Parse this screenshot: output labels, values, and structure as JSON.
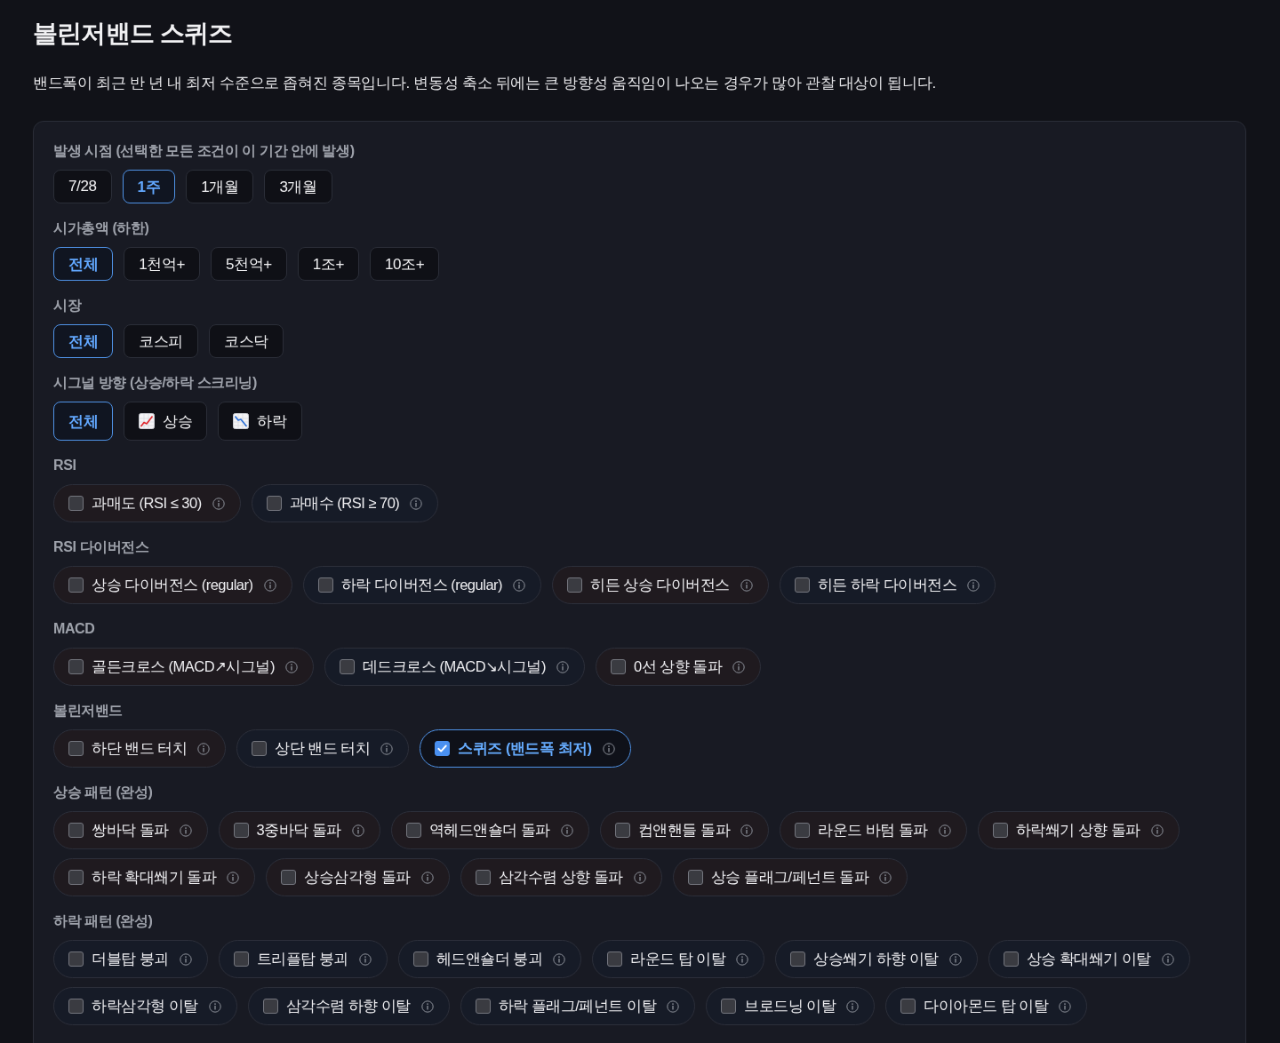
{
  "page": {
    "title": "볼린저밴드 스퀴즈",
    "description": "밴드폭이 최근 반 년 내 최저 수준으로 좁혀진 종목입니다. 변동성 축소 뒤에는 큰 방향성 움직임이 나오는 경우가 많아 관찰 대상이 됩니다."
  },
  "filters": {
    "groups": [
      {
        "kind": "buttons",
        "label": "발생 시점 (선택한 모든 조건이 이 기간 안에 발생)",
        "options": [
          {
            "label": "7/28",
            "selected": false
          },
          {
            "label": "1주",
            "selected": true
          },
          {
            "label": "1개월",
            "selected": false
          },
          {
            "label": "3개월",
            "selected": false
          }
        ]
      },
      {
        "kind": "buttons",
        "label": "시가총액 (하한)",
        "options": [
          {
            "label": "전체",
            "selected": true
          },
          {
            "label": "1천억+",
            "selected": false
          },
          {
            "label": "5천억+",
            "selected": false
          },
          {
            "label": "1조+",
            "selected": false
          },
          {
            "label": "10조+",
            "selected": false
          }
        ]
      },
      {
        "kind": "buttons",
        "label": "시장",
        "options": [
          {
            "label": "전체",
            "selected": true
          },
          {
            "label": "코스피",
            "selected": false
          },
          {
            "label": "코스닥",
            "selected": false
          }
        ]
      },
      {
        "kind": "buttons",
        "label": "시그널 방향 (상승/하락 스크리닝)",
        "options": [
          {
            "label": "전체",
            "selected": true,
            "kind": "plain"
          },
          {
            "label": "상승",
            "selected": false,
            "kind": "rising"
          },
          {
            "label": "하락",
            "selected": false,
            "kind": "falling"
          }
        ]
      },
      {
        "kind": "checkboxes",
        "label": "RSI",
        "options": [
          {
            "label": "과매도 (RSI ≤ 30)",
            "checked": false,
            "kind": "bullish"
          },
          {
            "label": "과매수 (RSI ≥ 70)",
            "checked": false,
            "kind": "bearish"
          }
        ]
      },
      {
        "kind": "checkboxes",
        "label": "RSI 다이버전스",
        "options": [
          {
            "label": "상승 다이버전스 (regular)",
            "checked": false,
            "kind": "bullish"
          },
          {
            "label": "하락 다이버전스 (regular)",
            "checked": false,
            "kind": "bearish"
          },
          {
            "label": "히든 상승 다이버전스",
            "checked": false,
            "kind": "bullish"
          },
          {
            "label": "히든 하락 다이버전스",
            "checked": false,
            "kind": "bearish"
          }
        ]
      },
      {
        "kind": "checkboxes",
        "label": "MACD",
        "options": [
          {
            "label": "골든크로스 (MACD↗시그널)",
            "checked": false,
            "kind": "bullish"
          },
          {
            "label": "데드크로스 (MACD↘시그널)",
            "checked": false,
            "kind": "bearish"
          },
          {
            "label": "0선 상향 돌파",
            "checked": false,
            "kind": "bullish"
          }
        ]
      },
      {
        "kind": "checkboxes",
        "label": "볼린저밴드",
        "options": [
          {
            "label": "하단 밴드 터치",
            "checked": false,
            "kind": "bullish"
          },
          {
            "label": "상단 밴드 터치",
            "checked": false,
            "kind": "bearish"
          },
          {
            "label": "스퀴즈 (밴드폭 최저)",
            "checked": true,
            "kind": "neutral"
          }
        ]
      },
      {
        "kind": "checkboxes",
        "label": "상승 패턴 (완성)",
        "options": [
          {
            "label": "쌍바닥 돌파",
            "checked": false,
            "kind": "bullish"
          },
          {
            "label": "3중바닥 돌파",
            "checked": false,
            "kind": "bullish"
          },
          {
            "label": "역헤드앤숄더 돌파",
            "checked": false,
            "kind": "bullish"
          },
          {
            "label": "컵앤핸들 돌파",
            "checked": false,
            "kind": "bullish"
          },
          {
            "label": "라운드 바텀 돌파",
            "checked": false,
            "kind": "bullish"
          },
          {
            "label": "하락쐐기 상향 돌파",
            "checked": false,
            "kind": "bullish"
          },
          {
            "label": "하락 확대쐐기 돌파",
            "checked": false,
            "kind": "bullish"
          },
          {
            "label": "상승삼각형 돌파",
            "checked": false,
            "kind": "bullish"
          },
          {
            "label": "삼각수렴 상향 돌파",
            "checked": false,
            "kind": "bullish"
          },
          {
            "label": "상승 플래그/페넌트 돌파",
            "checked": false,
            "kind": "bullish"
          }
        ]
      },
      {
        "kind": "checkboxes",
        "label": "하락 패턴 (완성)",
        "options": [
          {
            "label": "더블탑 붕괴",
            "checked": false,
            "kind": "bearish"
          },
          {
            "label": "트리플탑 붕괴",
            "checked": false,
            "kind": "bearish"
          },
          {
            "label": "헤드앤숄더 붕괴",
            "checked": false,
            "kind": "bearish"
          },
          {
            "label": "라운드 탑 이탈",
            "checked": false,
            "kind": "bearish"
          },
          {
            "label": "상승쐐기 하향 이탈",
            "checked": false,
            "kind": "bearish"
          },
          {
            "label": "상승 확대쐐기 이탈",
            "checked": false,
            "kind": "bearish"
          },
          {
            "label": "하락삼각형 이탈",
            "checked": false,
            "kind": "bearish"
          },
          {
            "label": "삼각수렴 하향 이탈",
            "checked": false,
            "kind": "bearish"
          },
          {
            "label": "하락 플래그/페넌트 이탈",
            "checked": false,
            "kind": "bearish"
          },
          {
            "label": "브로드닝 이탈",
            "checked": false,
            "kind": "bearish"
          },
          {
            "label": "다이아몬드 탑 이탈",
            "checked": false,
            "kind": "bearish"
          }
        ]
      }
    ]
  }
}
